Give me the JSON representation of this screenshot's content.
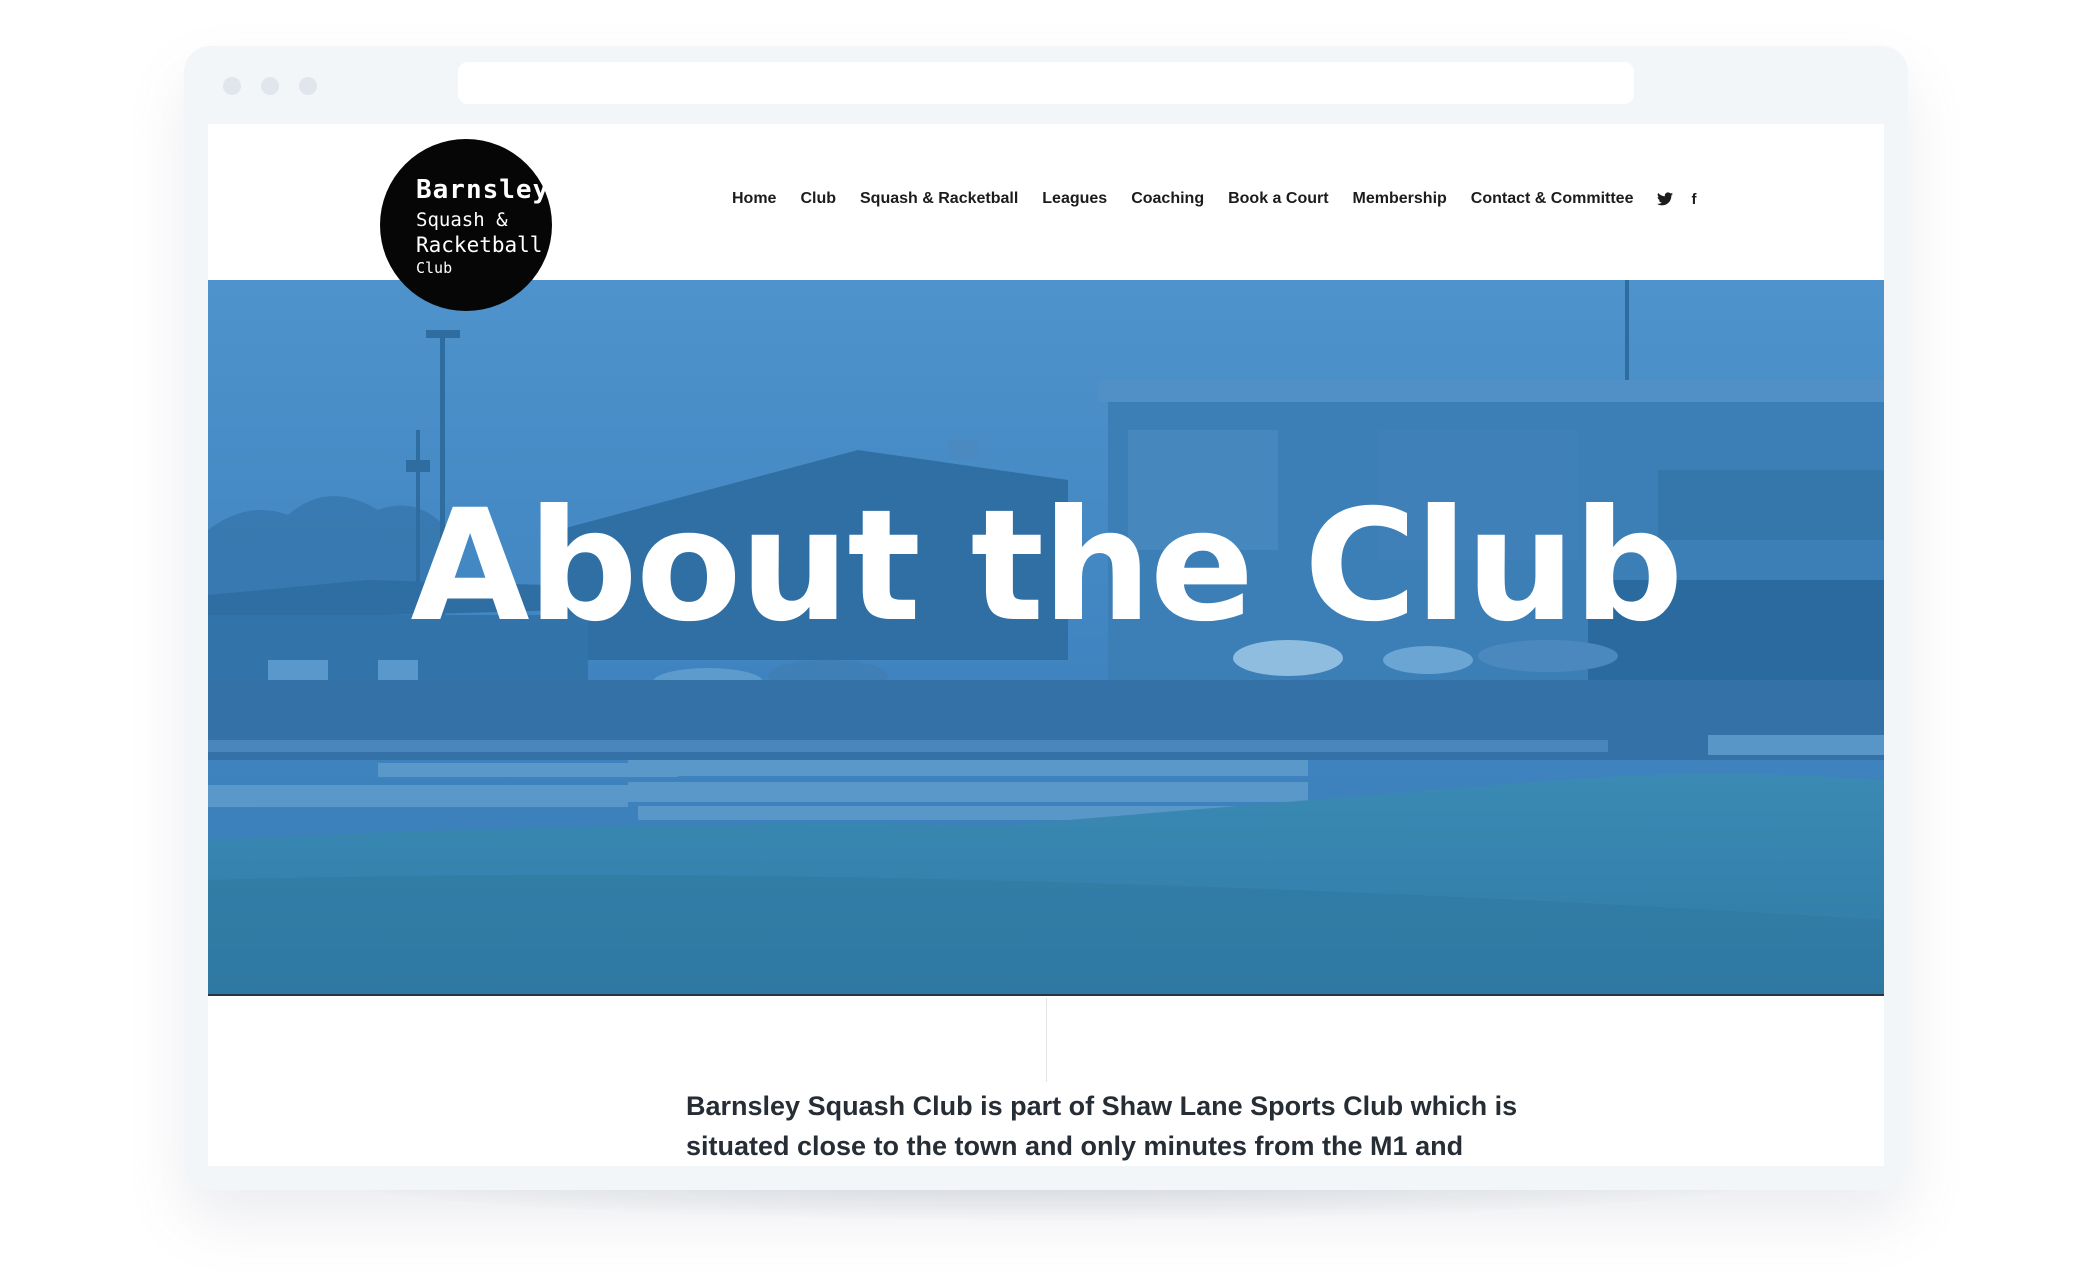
{
  "site": {
    "logo": {
      "line1": "Barnsley",
      "line2": "Squash &",
      "line3": "Racketball",
      "line4": "Club"
    },
    "nav": [
      {
        "label": "Home"
      },
      {
        "label": "Club"
      },
      {
        "label": "Squash & Racketball"
      },
      {
        "label": "Leagues"
      },
      {
        "label": "Coaching"
      },
      {
        "label": "Book a Court"
      },
      {
        "label": "Membership"
      },
      {
        "label": "Contact & Committee"
      }
    ],
    "social": {
      "twitter": "twitter-icon",
      "facebook_glyph": "f"
    }
  },
  "hero": {
    "title": "About the Club",
    "overlay_color": "#3d86c6"
  },
  "content": {
    "intro_line1": "Barnsley Squash Club is part of Shaw Lane Sports Club which is",
    "intro_line2": "situated close to the town and only minutes from the M1 and"
  },
  "colors": {
    "frame": "#f3f6f9",
    "logo_bg": "#060606",
    "nav_text": "#1c1c1c",
    "body_text": "#262d35"
  }
}
